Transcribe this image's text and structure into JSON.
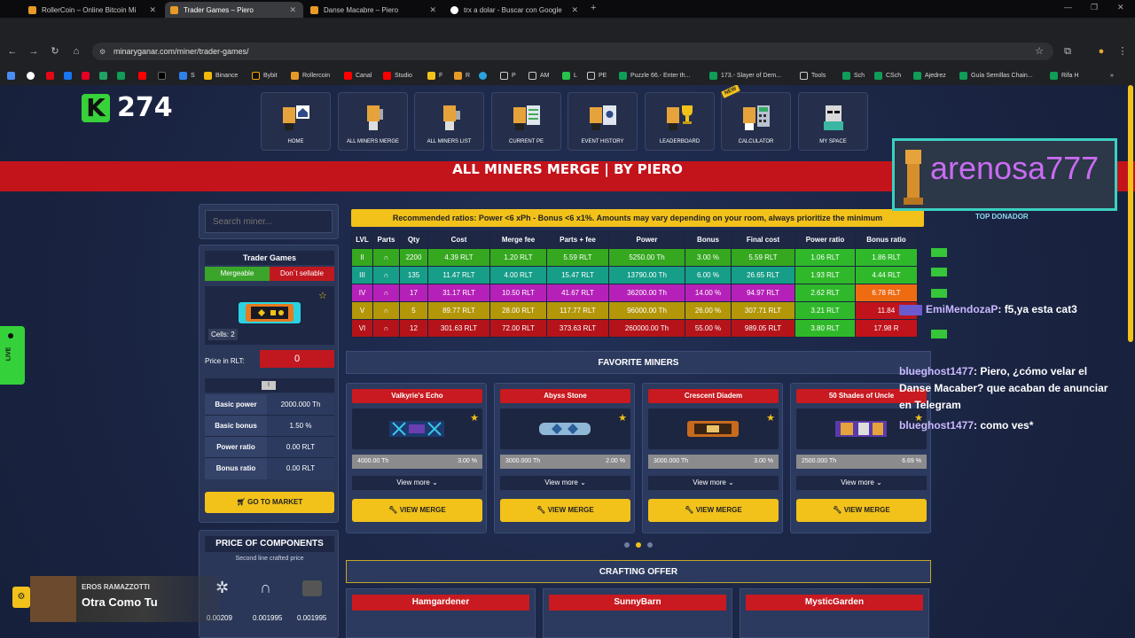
{
  "browser": {
    "tabs": [
      {
        "label": "RollerCoin – Online Bitcoin Mi",
        "active": false
      },
      {
        "label": "Trader Games – Piero",
        "active": true
      },
      {
        "label": "Danse Macabre – Piero",
        "active": false
      },
      {
        "label": "trx a dolar - Buscar con Google",
        "active": false
      }
    ],
    "url": "minaryganar.com/miner/trader-games/",
    "bookmarks": [
      "S",
      "Binance",
      "Bybit",
      "Rollercoin",
      "Canal",
      "Studio",
      "F",
      "R",
      "P",
      "AM",
      "L",
      "PE",
      "Puzzle 66.- Enter th...",
      "173.- Slayer of Dem...",
      "Tools",
      "Sch",
      "CSch",
      "Ajedrez",
      "Guía Semillas Chain...",
      "Rifa H"
    ]
  },
  "logo": {
    "letter": "K",
    "number": "274"
  },
  "nav": [
    {
      "label": "HOME"
    },
    {
      "label": "ALL MINERS MERGE"
    },
    {
      "label": "ALL MINERS LIST"
    },
    {
      "label": "CURRENT PE"
    },
    {
      "label": "EVENT HISTORY"
    },
    {
      "label": "LEADERBOARD"
    },
    {
      "label": "CALCULATOR",
      "badge": "NEW"
    },
    {
      "label": "MY SPACE"
    }
  ],
  "banner": "ALL MINERS MERGE | BY PIERO",
  "search": {
    "placeholder": "Search miner..."
  },
  "selected": {
    "title": "Trader Games",
    "mergeable": "Mergeable",
    "sellable": "Don´t sellable",
    "cells": "Cells: 2",
    "price_label": "Price in RLT:",
    "price_value": "0",
    "toggle": "I",
    "stats": [
      {
        "label": "Basic power",
        "value": "2000.000 Th"
      },
      {
        "label": "Basic bonus",
        "value": "1.50 %"
      },
      {
        "label": "Power ratio",
        "value": "0.00 RLT"
      },
      {
        "label": "Bonus ratio",
        "value": "0.00 RLT"
      }
    ],
    "market_btn": "GO TO MARKET"
  },
  "components": {
    "title": "PRICE OF COMPONENTS",
    "subtitle": "Second line crafted price",
    "prices": [
      "0.00209",
      "0.001995",
      "0.001995"
    ]
  },
  "recommend": "Recommended ratios: Power <6 xPh - Bonus <6 x1%. Amounts may vary depending on your room, always prioritize the minimum",
  "table": {
    "headers": [
      "LVL",
      "Parts",
      "Qty",
      "Cost",
      "Merge fee",
      "Parts + fee",
      "Power",
      "Bonus",
      "Final cost",
      "Power ratio",
      "Bonus ratio"
    ],
    "rows": [
      {
        "lvl": "II",
        "qty": "2200",
        "cost": "4.39 RLT",
        "fee": "1.20 RLT",
        "pf": "5.59 RLT",
        "power": "5250.00 Th",
        "bonus": "3.00 %",
        "final": "5.59 RLT",
        "pr": "1.06 RLT",
        "br": "1.86 RLT"
      },
      {
        "lvl": "III",
        "qty": "135",
        "cost": "11.47 RLT",
        "fee": "4.00 RLT",
        "pf": "15.47 RLT",
        "power": "13790.00 Th",
        "bonus": "6.00 %",
        "final": "26.65 RLT",
        "pr": "1.93 RLT",
        "br": "4.44 RLT"
      },
      {
        "lvl": "IV",
        "qty": "17",
        "cost": "31.17 RLT",
        "fee": "10.50 RLT",
        "pf": "41.67 RLT",
        "power": "36200.00 Th",
        "bonus": "14.00 %",
        "final": "94.97 RLT",
        "pr": "2.62 RLT",
        "br": "6.78 RLT"
      },
      {
        "lvl": "V",
        "qty": "5",
        "cost": "89.77 RLT",
        "fee": "28.00 RLT",
        "pf": "117.77 RLT",
        "power": "96000.00 Th",
        "bonus": "26.00 %",
        "final": "307.71 RLT",
        "pr": "3.21 RLT",
        "br": "11.84"
      },
      {
        "lvl": "VI",
        "qty": "12",
        "cost": "301.63 RLT",
        "fee": "72.00 RLT",
        "pf": "373.63 RLT",
        "power": "260000.00 Th",
        "bonus": "55.00 %",
        "final": "989.05 RLT",
        "pr": "3.80 RLT",
        "br": "17.98 R"
      }
    ]
  },
  "favorites": {
    "title": "FAVORITE MINERS",
    "items": [
      {
        "name": "Valkyrie's Echo",
        "power": "4000.00 Th",
        "bonus": "3.00 %"
      },
      {
        "name": "Abyss Stone",
        "power": "3000.000 Th",
        "bonus": "2.00 %"
      },
      {
        "name": "Crescent Diadem",
        "power": "3000.000 Th",
        "bonus": "3.00 %"
      },
      {
        "name": "50 Shades of Uncle",
        "power": "2500.000 Th",
        "bonus": "6.69 %"
      }
    ],
    "view_more": "View more",
    "view_merge": "VIEW MERGE"
  },
  "crafting": {
    "title": "CRAFTING OFFER",
    "items": [
      "Hamgardener",
      "SunnyBarn",
      "MysticGarden"
    ]
  },
  "overlay": {
    "donor_name": "arenosa777",
    "donor_label": "TOP DONADOR",
    "chat": [
      {
        "user": "EmiMendozaP",
        "msg": ": f5,ya esta cat3"
      },
      {
        "user": "blueghost1477",
        "msg": ": Piero, ¿cómo velar el Danse Macaber? que acaban de anunciar en Telegram"
      },
      {
        "user": "blueghost1477",
        "msg": ": como ves*"
      }
    ],
    "live": "LIVE",
    "music_artist": "EROS RAMAZZOTTI",
    "music_title": "Otra Como Tu"
  }
}
